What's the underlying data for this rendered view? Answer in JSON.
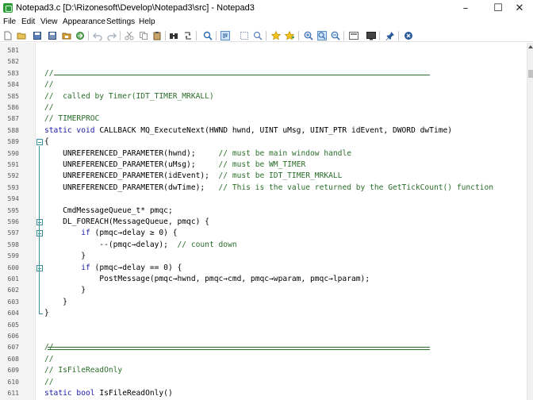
{
  "window": {
    "title": "Notepad3.c [D:\\Rizonesoft\\Develop\\Notepad3\\src] - Notepad3",
    "controls": {
      "minimize": "–",
      "maximize": "☐",
      "close": "✕"
    }
  },
  "menu": [
    "File",
    "Edit",
    "View",
    "Appearance",
    "Settings",
    "Help"
  ],
  "toolbar": {
    "icons": [
      "new-file-icon",
      "open-file-icon",
      "save-icon",
      "save-as-icon",
      "browse-icon",
      "recent-icon",
      "undo-icon",
      "redo-icon",
      "cut-icon",
      "copy-icon",
      "paste-icon",
      "find-icon",
      "replace-icon",
      "goto-icon",
      "word-wrap-icon",
      "whitespace-icon",
      "zoom-search-icon",
      "bookmark-icon",
      "bookmark-add-icon",
      "zoom-in-icon",
      "zoom-reset-icon",
      "zoom-out-icon",
      "scheme-icon",
      "screen-icon",
      "pin-icon",
      "exit-icon"
    ]
  },
  "editor": {
    "lines": [
      {
        "num": "581",
        "segments": []
      },
      {
        "num": "582",
        "segments": []
      },
      {
        "num": "583",
        "segments": [
          {
            "t": "//",
            "c": "c-comment"
          }
        ],
        "rule": "thin"
      },
      {
        "num": "584",
        "segments": [
          {
            "t": "//",
            "c": "c-comment"
          }
        ]
      },
      {
        "num": "585",
        "segments": [
          {
            "t": "//  called by Timer(IDT_TIMER_MRKALL)",
            "c": "c-comment"
          }
        ]
      },
      {
        "num": "586",
        "segments": [
          {
            "t": "//",
            "c": "c-comment"
          }
        ]
      },
      {
        "num": "587",
        "segments": [
          {
            "t": "// TIMERPROC",
            "c": "c-comment"
          }
        ]
      },
      {
        "num": "588",
        "segments": [
          {
            "t": "static void ",
            "c": "c-kw"
          },
          {
            "t": "CALLBACK MQ_ExecuteNext(HWND hwnd, UINT uMsg, UINT_PTR idEvent, DWORD dwTime)",
            "c": "c-plain"
          }
        ]
      },
      {
        "num": "589",
        "segments": [
          {
            "t": "{",
            "c": "c-plain"
          }
        ],
        "fold": "open"
      },
      {
        "num": "590",
        "segments": [
          {
            "t": "    UNREFERENCED_PARAMETER(hwnd);     ",
            "c": "c-plain"
          },
          {
            "t": "// must be main window handle",
            "c": "c-comment"
          }
        ]
      },
      {
        "num": "591",
        "segments": [
          {
            "t": "    UNREFERENCED_PARAMETER(uMsg);     ",
            "c": "c-plain"
          },
          {
            "t": "// must be WM_TIMER",
            "c": "c-comment"
          }
        ]
      },
      {
        "num": "592",
        "segments": [
          {
            "t": "    UNREFERENCED_PARAMETER(idEvent);  ",
            "c": "c-plain"
          },
          {
            "t": "// must be IDT_TIMER_MRKALL",
            "c": "c-comment"
          }
        ]
      },
      {
        "num": "593",
        "segments": [
          {
            "t": "    UNREFERENCED_PARAMETER(dwTime);   ",
            "c": "c-plain"
          },
          {
            "t": "// This is the value returned by the GetTickCount() function",
            "c": "c-comment"
          }
        ]
      },
      {
        "num": "594",
        "segments": []
      },
      {
        "num": "595",
        "segments": [
          {
            "t": "    CmdMessageQueue_t* pmqc;",
            "c": "c-plain"
          }
        ]
      },
      {
        "num": "596",
        "segments": [
          {
            "t": "    DL_FOREACH(MessageQueue, pmqc) {",
            "c": "c-plain"
          }
        ],
        "fold": "open"
      },
      {
        "num": "597",
        "segments": [
          {
            "t": "        ",
            "c": "c-plain"
          },
          {
            "t": "if ",
            "c": "c-kw"
          },
          {
            "t": "(pmqc→delay ≥ 0) {",
            "c": "c-plain"
          }
        ],
        "fold": "open"
      },
      {
        "num": "598",
        "segments": [
          {
            "t": "            --(pmqc→delay);  ",
            "c": "c-plain"
          },
          {
            "t": "// count down",
            "c": "c-comment"
          }
        ]
      },
      {
        "num": "599",
        "segments": [
          {
            "t": "        }",
            "c": "c-plain"
          }
        ]
      },
      {
        "num": "600",
        "segments": [
          {
            "t": "        ",
            "c": "c-plain"
          },
          {
            "t": "if ",
            "c": "c-kw"
          },
          {
            "t": "(pmqc→delay == 0) {",
            "c": "c-plain"
          }
        ],
        "fold": "open"
      },
      {
        "num": "601",
        "segments": [
          {
            "t": "            PostMessage(pmqc→hwnd, pmqc→cmd, pmqc→wparam, pmqc→lparam);",
            "c": "c-plain"
          }
        ]
      },
      {
        "num": "602",
        "segments": [
          {
            "t": "        }",
            "c": "c-plain"
          }
        ]
      },
      {
        "num": "603",
        "segments": [
          {
            "t": "    }",
            "c": "c-plain"
          }
        ]
      },
      {
        "num": "604",
        "segments": [
          {
            "t": "}",
            "c": "c-plain"
          }
        ]
      },
      {
        "num": "605",
        "segments": []
      },
      {
        "num": "606",
        "segments": []
      },
      {
        "num": "607",
        "segments": [
          {
            "t": "//",
            "c": "c-comment"
          }
        ],
        "rule": "double"
      },
      {
        "num": "608",
        "segments": [
          {
            "t": "//",
            "c": "c-comment"
          }
        ]
      },
      {
        "num": "609",
        "segments": [
          {
            "t": "// IsFileReadOnly",
            "c": "c-comment"
          }
        ]
      },
      {
        "num": "610",
        "segments": [
          {
            "t": "//",
            "c": "c-comment"
          }
        ]
      },
      {
        "num": "611",
        "segments": [
          {
            "t": "static bool ",
            "c": "c-kw"
          },
          {
            "t": "IsFileReadOnly()",
            "c": "c-plain"
          }
        ]
      }
    ]
  }
}
